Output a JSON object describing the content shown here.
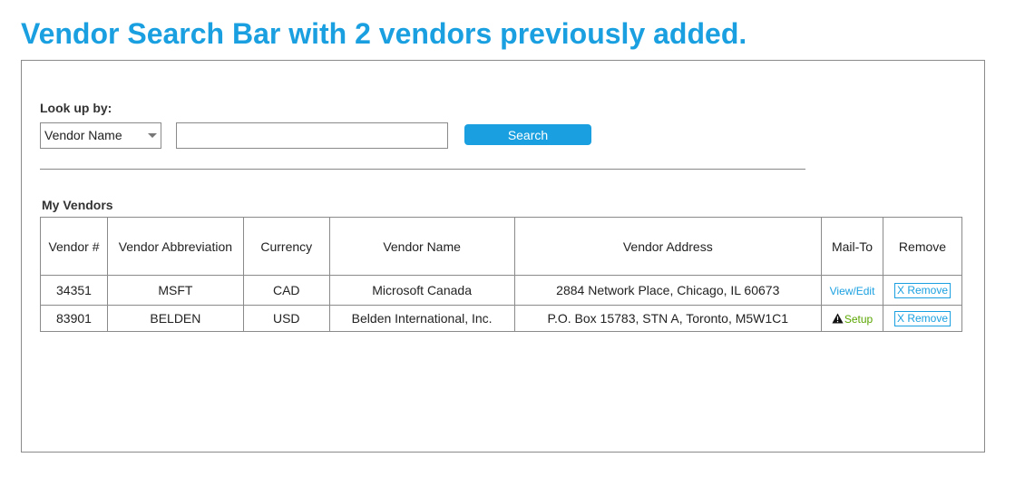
{
  "page": {
    "title": "Vendor Search Bar with 2 vendors previously added."
  },
  "lookup": {
    "label": "Look up by:",
    "selected": "Vendor Name",
    "input_value": "",
    "search_label": "Search"
  },
  "vendors": {
    "section_title": "My Vendors",
    "columns": [
      "Vendor #",
      "Vendor Abbreviation",
      "Currency",
      "Vendor Name",
      "Vendor Address",
      "Mail-To",
      "Remove"
    ],
    "rows": [
      {
        "number": "34351",
        "abbr": "MSFT",
        "currency": "CAD",
        "name": "Microsoft Canada",
        "address": "2884 Network Place, Chicago, IL 60673",
        "mailto": "View/Edit",
        "remove": "X Remove"
      },
      {
        "number": "83901",
        "abbr": "BELDEN",
        "currency": "USD",
        "name": "Belden International, Inc.",
        "address": "P.O. Box 15783, STN A, Toronto, M5W1C1",
        "mailto": "Setup",
        "remove": "X Remove"
      }
    ]
  },
  "colors": {
    "accent": "#1aa0e0",
    "setup": "#5aa500",
    "border": "#8a8a8a"
  },
  "icons": {
    "warning": "warning-icon",
    "dropdown": "chevron-down-icon"
  }
}
